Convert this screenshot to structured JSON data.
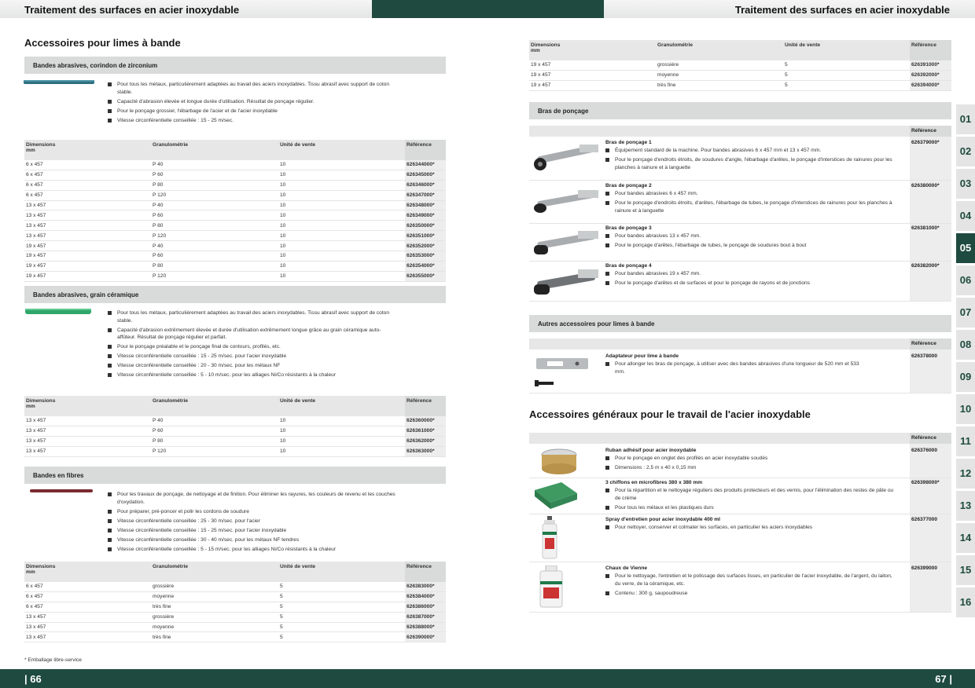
{
  "header": {
    "left_title": "Traitement des surfaces en acier inoxydable",
    "right_title": "Traitement des surfaces en acier inoxydable"
  },
  "left": {
    "section_title": "Accessoires pour limes à bande",
    "zirc": {
      "band": "Bandes abrasives, corindon de zirconium",
      "bullets": [
        "Pour tous les métaux, particulièrement adaptées au travail des aciers inoxydables. Tissu abrasif avec support de coton stable.",
        "Capacité d'abrasion élevée et longue durée d'utilisation. Résultat de ponçage régulier.",
        "Pour le ponçage grossier, l'ébarbage de l'acier et de l'acier inoxydable",
        "Vitesse circonférentielle conseillée : 15 - 25 m/sec."
      ],
      "rows": [
        [
          "6 x 457",
          "P 40",
          "10",
          "626344000*"
        ],
        [
          "6 x 457",
          "P 60",
          "10",
          "626345000*"
        ],
        [
          "6 x 457",
          "P 80",
          "10",
          "626346000*"
        ],
        [
          "6 x 457",
          "P 120",
          "10",
          "626347000*"
        ],
        [
          "13 x 457",
          "P 40",
          "10",
          "626348000*"
        ],
        [
          "13 x 457",
          "P 60",
          "10",
          "626349000*"
        ],
        [
          "13 x 457",
          "P 80",
          "10",
          "626350000*"
        ],
        [
          "13 x 457",
          "P 120",
          "10",
          "626351000*"
        ],
        [
          "19 x 457",
          "P 40",
          "10",
          "626352000*"
        ],
        [
          "19 x 457",
          "P 60",
          "10",
          "626353000*"
        ],
        [
          "19 x 457",
          "P 80",
          "10",
          "626354000*"
        ],
        [
          "19 x 457",
          "P 120",
          "10",
          "626355000*"
        ]
      ]
    },
    "ceram": {
      "band": "Bandes abrasives, grain céramique",
      "bullets": [
        "Pour tous les métaux, particulièrement adaptées au travail des aciers inoxydables. Tissu abrasif avec support de coton stable.",
        "Capacité d'abrasion extrêmement élevée et durée d'utilisation extrêmement longue grâce au grain céramique auto-affûteur. Résultat de ponçage régulier et parfait.",
        "Pour le ponçage préalable et le ponçage final de contours, profilés, etc.",
        "Vitesse circonférentielle conseillée : 15 - 25 m/sec. pour l'acier inoxydable",
        "Vitesse circonférentielle conseillée : 20 - 30 m/sec. pour les métaux NF",
        "Vitesse circonférentielle conseillée : 5 - 10 m/sec. pour les alliages Ni/Co résistants à la chaleur"
      ],
      "rows": [
        [
          "13 x 457",
          "P 40",
          "10",
          "626360000*"
        ],
        [
          "13 x 457",
          "P 60",
          "10",
          "626361000*"
        ],
        [
          "13 x 457",
          "P 80",
          "10",
          "626362000*"
        ],
        [
          "13 x 457",
          "P 120",
          "10",
          "626363000*"
        ]
      ]
    },
    "fibre": {
      "band": "Bandes en fibres",
      "bullets": [
        "Pour les travaux de ponçage, de nettoyage et de finition. Pour éliminer les rayures, les couleurs de revenu et les couches d'oxydation.",
        "Pour préparer, pré-poncer et polir les cordons de soudure",
        "Vitesse circonférentielle conseillée : 25 - 30 m/sec. pour l'acier",
        "Vitesse circonférentielle conseillée : 15 - 25 m/sec. pour l'acier inoxydable",
        "Vitesse circonférentielle conseillée : 30 - 40 m/sec. pour les métaux NF tendres",
        "Vitesse circonférentielle conseillée : 5 - 15 m/sec. pour les alliages Ni/Co résistants à la chaleur"
      ],
      "rows": [
        [
          "6 x 457",
          "grossière",
          "5",
          "626383000*"
        ],
        [
          "6 x 457",
          "moyenne",
          "5",
          "626384000*"
        ],
        [
          "6 x 457",
          "très fine",
          "5",
          "626386000*"
        ],
        [
          "13 x 457",
          "grossière",
          "5",
          "626387000*"
        ],
        [
          "13 x 457",
          "moyenne",
          "5",
          "626388000*"
        ],
        [
          "13 x 457",
          "très fine",
          "5",
          "626390000*"
        ]
      ]
    },
    "col_headers": {
      "dim": "Dimensions",
      "dim_unit": "mm",
      "grain": "Granulométrie",
      "unit": "Unité de vente",
      "ref": "Référence"
    },
    "footnote": "* Emballage libre-service",
    "page_number": "| 66"
  },
  "right": {
    "top_rows": [
      [
        "19 x 457",
        "grossière",
        "5",
        "626391000*"
      ],
      [
        "19 x 457",
        "moyenne",
        "5",
        "626392000*"
      ],
      [
        "19 x 457",
        "très fine",
        "5",
        "626394000*"
      ]
    ],
    "arms_band": "Bras de ponçage",
    "ref_label": "Référence",
    "arms": [
      {
        "name": "Bras de ponçage 1",
        "ref": "626379000*",
        "bullets": [
          "Équipement standard de la machine. Pour bandes abrasives 6 x 457 mm et 13 x 457 mm.",
          "Pour le ponçage d'endroits étroits, de soudures d'angle, l'ébarbage d'arêtes, le ponçage d'interstices de rainures pour les planches à rainure et à languette"
        ]
      },
      {
        "name": "Bras de ponçage 2",
        "ref": "626380000*",
        "bullets": [
          "Pour bandes abrasives 6 x 457 mm.",
          "Pour le ponçage d'endroits étroits, d'arêtes, l'ébarbage de tubes, le ponçage d'interstices de rainures pour les planches à rainure et à languette"
        ]
      },
      {
        "name": "Bras de ponçage 3",
        "ref": "626381000*",
        "bullets": [
          "Pour bandes abrasives 13 x 457 mm.",
          "Pour le ponçage d'arêtes, l'ébarbage de tubes, le ponçage de soudures bout à bout"
        ]
      },
      {
        "name": "Bras de ponçage 4",
        "ref": "626382000*",
        "bullets": [
          "Pour bandes abrasives 19 x 457 mm.",
          "Pour le ponçage d'arêtes et de surfaces et pour le ponçage de rayons et de jonctions"
        ]
      }
    ],
    "other_band": "Autres accessoires pour limes à bande",
    "adapter": {
      "name": "Adaptateur pour lime à bande",
      "ref": "626378000",
      "bullets": [
        "Pour allonger les bras de ponçage, à utiliser avec des bandes abrasives d'une longueur de 520 mm et 533 mm."
      ]
    },
    "general_title": "Accessoires généraux pour le travail de l'acier inoxydable",
    "general": [
      {
        "name": "Ruban adhésif pour acier inoxydable",
        "ref": "626376000",
        "bullets": [
          "Pour le ponçage en onglet des profilés en acier inoxydable soudés",
          "Dimensions : 2,5 m x 40 x 0,15 mm"
        ]
      },
      {
        "name": "3 chiffons en microfibres 380 x 380 mm",
        "ref": "626398000*",
        "bullets": [
          "Pour la répartition et le nettoyage réguliers des produits protecteurs et des vernis, pour l'élimination des restes de pâte ou de crème",
          "Pour tous les métaux et les plastiques durs"
        ]
      },
      {
        "name": "Spray d'entretien pour acier inoxydable 400 ml",
        "ref": "626377000",
        "bullets": [
          "Pour nettoyer, conserver et colmater les surfaces, en particulier les aciers inoxydables"
        ]
      },
      {
        "name": "Chaux de Vienne",
        "ref": "626399000",
        "bullets": [
          "Pour le nettoyage, l'entretien et le polissage des surfaces lisses, en particulier de l'acier inoxydable, de l'argent, du laiton, du verre, de la céramique, etc.",
          "Contenu : 300 g, saupoudreuse"
        ]
      }
    ],
    "page_number": "67 |"
  },
  "tabs": [
    "01",
    "02",
    "03",
    "04",
    "05",
    "06",
    "07",
    "08",
    "09",
    "10",
    "11",
    "12",
    "13",
    "14",
    "15",
    "16"
  ],
  "active_tab": "05",
  "colors": {
    "brand": "#1e4a3f",
    "band": "#d9dbda"
  }
}
